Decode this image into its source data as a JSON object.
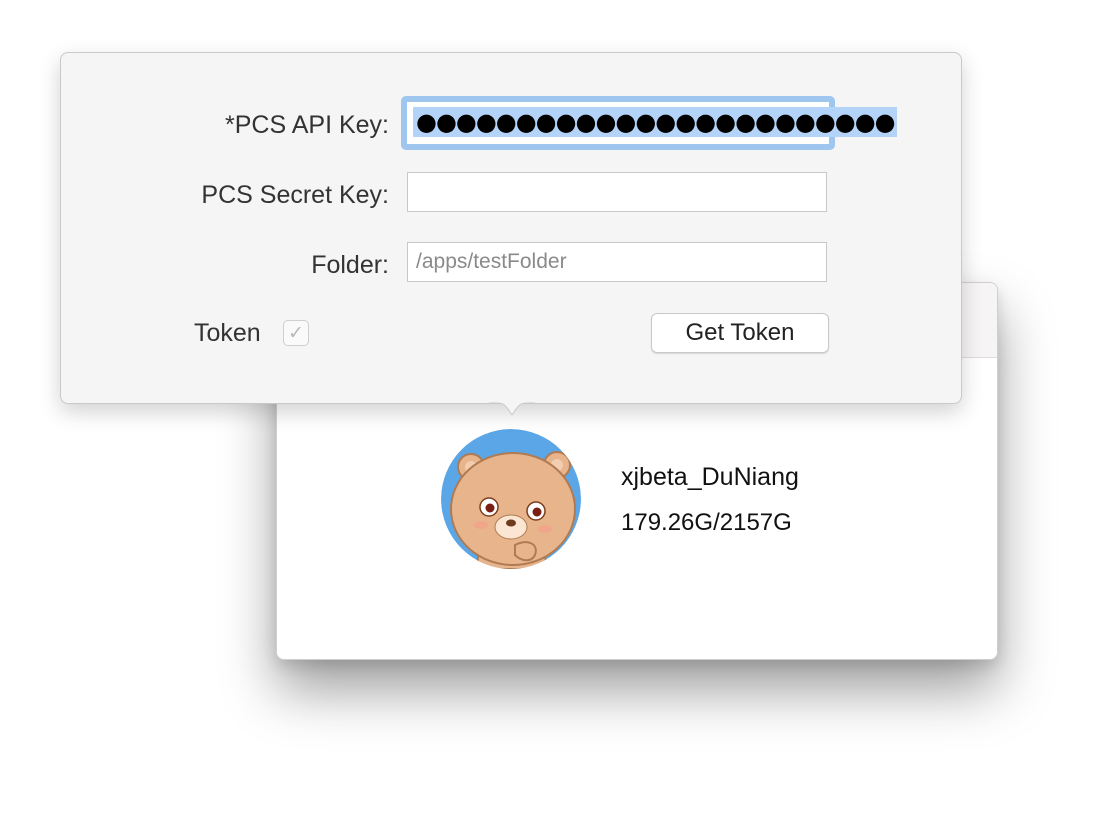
{
  "popover": {
    "api_key": {
      "label": "*PCS API Key:",
      "value_masked": "●●●●●●●●●●●●●●●●●●●●●●●●"
    },
    "secret_key": {
      "label": "PCS Secret Key:",
      "value": ""
    },
    "folder": {
      "label": "Folder:",
      "value": "",
      "placeholder": "/apps/testFolder"
    },
    "token": {
      "label": "Token",
      "checked": true,
      "check_glyph": "✓"
    },
    "get_token_label": "Get Token",
    "icons": {
      "checkbox": "checkmark-icon"
    }
  },
  "account": {
    "username": "xjbeta_DuNiang",
    "quota": "179.26G/2157G",
    "avatar": "bear-avatar-icon"
  },
  "colors": {
    "focus_ring": "#9ec6ee",
    "selection": "#b3d4f8",
    "popover_bg": "#f5f5f5",
    "avatar_bg": "#5aa6e6"
  }
}
